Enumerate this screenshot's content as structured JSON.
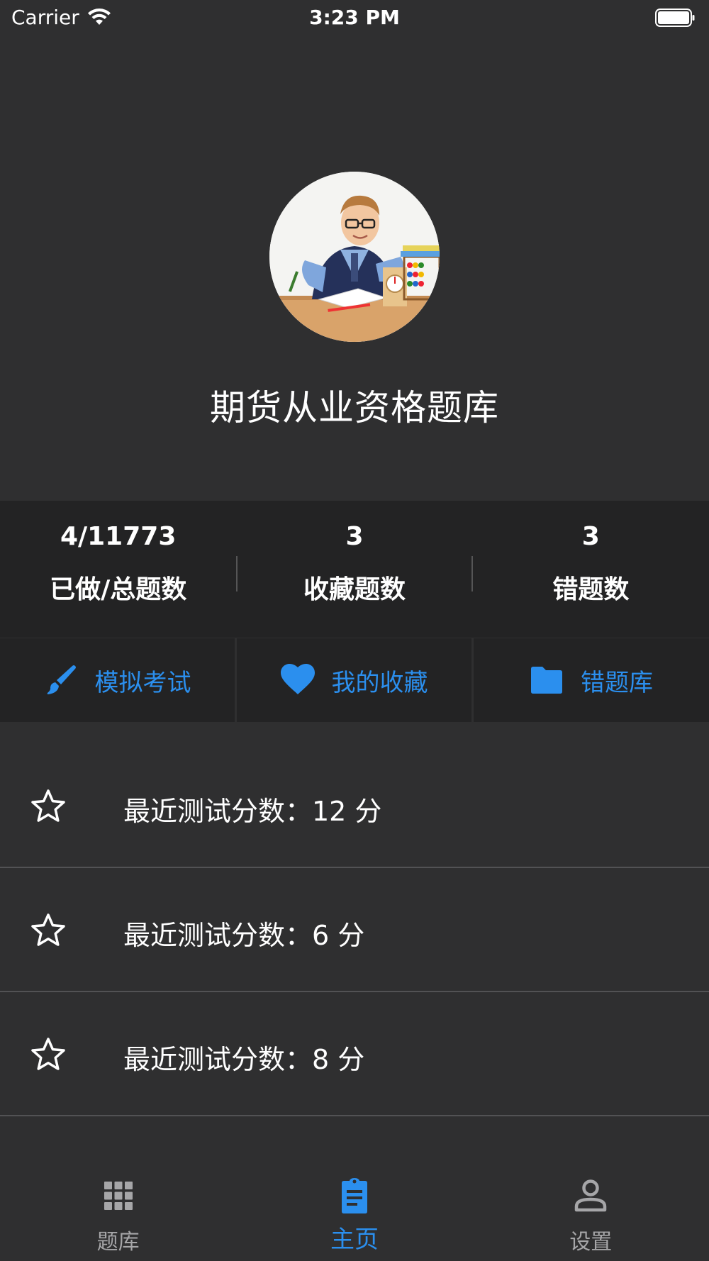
{
  "status_bar": {
    "carrier": "Carrier",
    "time": "3:23 PM"
  },
  "header": {
    "title": "期货从业资格题库"
  },
  "stats": [
    {
      "value": "4/11773",
      "label": "已做/总题数"
    },
    {
      "value": "3",
      "label": "收藏题数"
    },
    {
      "value": "3",
      "label": "错题数"
    }
  ],
  "actions": [
    {
      "label": "模拟考试",
      "icon": "brush-icon"
    },
    {
      "label": "我的收藏",
      "icon": "heart-icon"
    },
    {
      "label": "错题库",
      "icon": "folder-icon"
    }
  ],
  "scores": [
    {
      "text": "最近测试分数：12 分"
    },
    {
      "text": "最近测试分数：6 分"
    },
    {
      "text": "最近测试分数：8 分"
    }
  ],
  "tabs": [
    {
      "label": "题库",
      "icon": "grid-icon",
      "active": false
    },
    {
      "label": "主页",
      "icon": "clipboard-icon",
      "active": true
    },
    {
      "label": "设置",
      "icon": "person-icon",
      "active": false
    }
  ],
  "colors": {
    "background": "#2f2f30",
    "panel": "#232324",
    "accent": "#2b8fee",
    "tab_inactive": "#a6a6a8"
  }
}
